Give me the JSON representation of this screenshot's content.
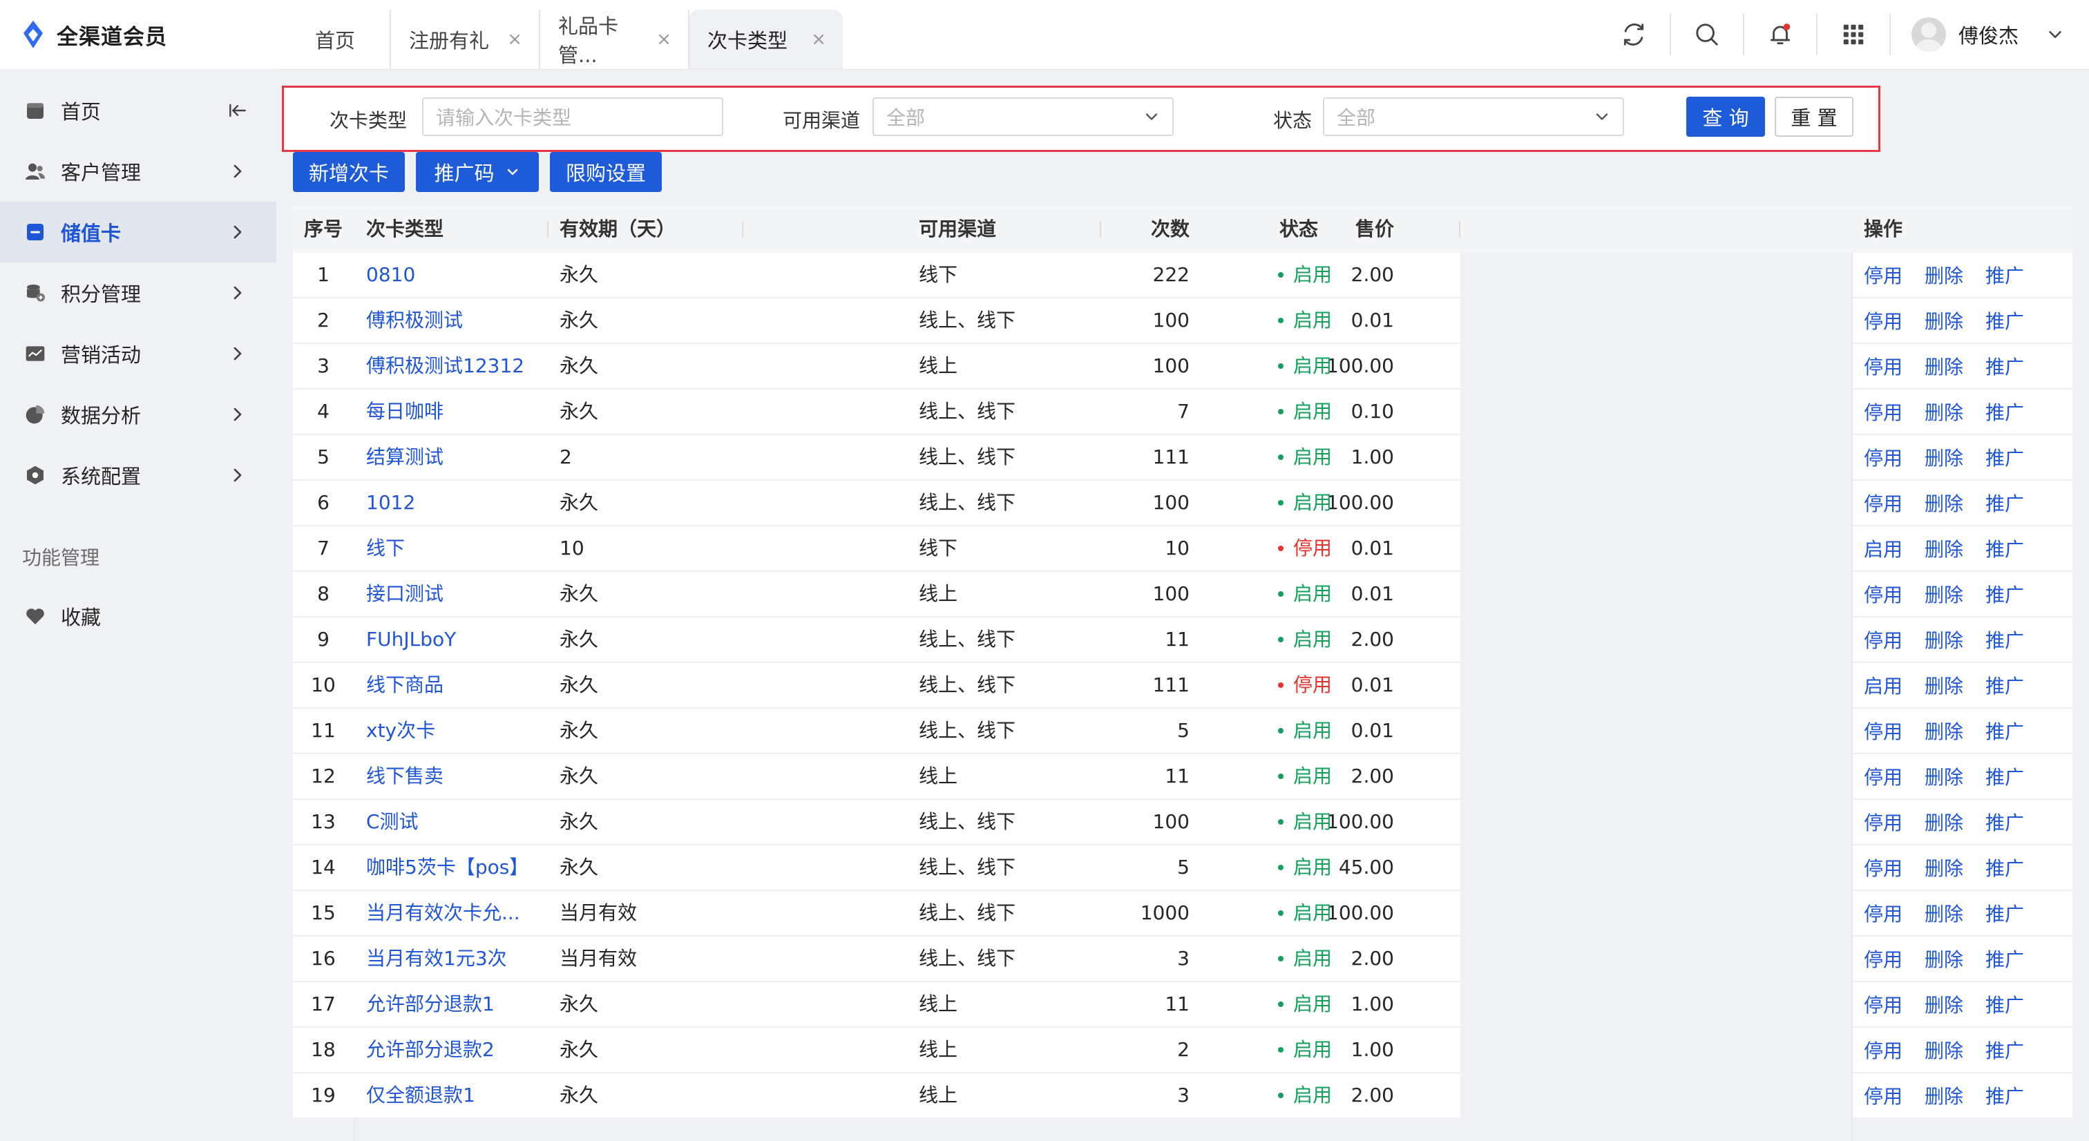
{
  "app": {
    "title": "全渠道会员"
  },
  "tabs": [
    {
      "label": "首页",
      "closable": false
    },
    {
      "label": "注册有礼",
      "closable": true
    },
    {
      "label": "礼品卡管...",
      "closable": true
    },
    {
      "label": "次卡类型",
      "closable": true,
      "active": true
    }
  ],
  "close_glyph": "×",
  "user": {
    "name": "傅俊杰"
  },
  "sidebar": {
    "items": [
      {
        "label": "首页",
        "icon": "home-icon"
      },
      {
        "label": "客户管理",
        "icon": "user-icon"
      },
      {
        "label": "储值卡",
        "icon": "card-icon",
        "active": true
      },
      {
        "label": "积分管理",
        "icon": "coins-icon"
      },
      {
        "label": "营销活动",
        "icon": "chart-board-icon"
      },
      {
        "label": "数据分析",
        "icon": "pie-icon"
      },
      {
        "label": "系统配置",
        "icon": "hexagon-icon"
      }
    ],
    "section": "功能管理",
    "favorites": {
      "label": "收藏",
      "icon": "heart-icon"
    }
  },
  "filters": {
    "card_type": {
      "label": "次卡类型",
      "placeholder": "请输入次卡类型"
    },
    "channel": {
      "label": "可用渠道",
      "value": "全部"
    },
    "status": {
      "label": "状态",
      "value": "全部"
    },
    "query_label": "查 询",
    "reset_label": "重 置"
  },
  "actions": {
    "add_label": "新增次卡",
    "promo_label": "推广码",
    "limit_label": "限购设置"
  },
  "table": {
    "headers": {
      "no": "序号",
      "type": "次卡类型",
      "validity": "有效期（天）",
      "count": "次数",
      "channel": "可用渠道",
      "price": "售价",
      "status": "状态",
      "ops": "操作"
    },
    "op_delete": "删除",
    "op_promote": "推广",
    "rows": [
      {
        "no": "1",
        "type": "0810",
        "validity": "永久",
        "count": "222",
        "channel": "线下",
        "price": "2.00",
        "status": "启用",
        "enabled": true,
        "toggle": "停用"
      },
      {
        "no": "2",
        "type": "傅积极测试",
        "validity": "永久",
        "count": "100",
        "channel": "线上、线下",
        "price": "0.01",
        "status": "启用",
        "enabled": true,
        "toggle": "停用"
      },
      {
        "no": "3",
        "type": "傅积极测试12312",
        "validity": "永久",
        "count": "100",
        "channel": "线上",
        "price": "100.00",
        "status": "启用",
        "enabled": true,
        "toggle": "停用"
      },
      {
        "no": "4",
        "type": "每日咖啡",
        "validity": "永久",
        "count": "7",
        "channel": "线上、线下",
        "price": "0.10",
        "status": "启用",
        "enabled": true,
        "toggle": "停用"
      },
      {
        "no": "5",
        "type": "结算测试",
        "validity": "2",
        "count": "111",
        "channel": "线上、线下",
        "price": "1.00",
        "status": "启用",
        "enabled": true,
        "toggle": "停用"
      },
      {
        "no": "6",
        "type": "1012",
        "validity": "永久",
        "count": "100",
        "channel": "线上、线下",
        "price": "100.00",
        "status": "启用",
        "enabled": true,
        "toggle": "停用"
      },
      {
        "no": "7",
        "type": "线下",
        "validity": "10",
        "count": "10",
        "channel": "线下",
        "price": "0.01",
        "status": "停用",
        "enabled": false,
        "toggle": "启用"
      },
      {
        "no": "8",
        "type": "接口测试",
        "validity": "永久",
        "count": "100",
        "channel": "线上",
        "price": "0.01",
        "status": "启用",
        "enabled": true,
        "toggle": "停用"
      },
      {
        "no": "9",
        "type": "FUhJLboY",
        "validity": "永久",
        "count": "11",
        "channel": "线上、线下",
        "price": "2.00",
        "status": "启用",
        "enabled": true,
        "toggle": "停用"
      },
      {
        "no": "10",
        "type": "线下商品",
        "validity": "永久",
        "count": "111",
        "channel": "线上、线下",
        "price": "0.01",
        "status": "停用",
        "enabled": false,
        "toggle": "启用"
      },
      {
        "no": "11",
        "type": "xty次卡",
        "validity": "永久",
        "count": "5",
        "channel": "线上、线下",
        "price": "0.01",
        "status": "启用",
        "enabled": true,
        "toggle": "停用"
      },
      {
        "no": "12",
        "type": "线下售卖",
        "validity": "永久",
        "count": "11",
        "channel": "线上",
        "price": "2.00",
        "status": "启用",
        "enabled": true,
        "toggle": "停用"
      },
      {
        "no": "13",
        "type": "C测试",
        "validity": "永久",
        "count": "100",
        "channel": "线上、线下",
        "price": "100.00",
        "status": "启用",
        "enabled": true,
        "toggle": "停用"
      },
      {
        "no": "14",
        "type": "咖啡5茨卡【pos】",
        "validity": "永久",
        "count": "5",
        "channel": "线上、线下",
        "price": "45.00",
        "status": "启用",
        "enabled": true,
        "toggle": "停用"
      },
      {
        "no": "15",
        "type": "当月有效次卡允...",
        "validity": "当月有效",
        "count": "1000",
        "channel": "线上、线下",
        "price": "100.00",
        "status": "启用",
        "enabled": true,
        "toggle": "停用"
      },
      {
        "no": "16",
        "type": "当月有效1元3次",
        "validity": "当月有效",
        "count": "3",
        "channel": "线上、线下",
        "price": "2.00",
        "status": "启用",
        "enabled": true,
        "toggle": "停用"
      },
      {
        "no": "17",
        "type": "允许部分退款1",
        "validity": "永久",
        "count": "11",
        "channel": "线上",
        "price": "1.00",
        "status": "启用",
        "enabled": true,
        "toggle": "停用"
      },
      {
        "no": "18",
        "type": "允许部分退款2",
        "validity": "永久",
        "count": "2",
        "channel": "线上",
        "price": "1.00",
        "status": "启用",
        "enabled": true,
        "toggle": "停用"
      },
      {
        "no": "19",
        "type": "仅全额退款1",
        "validity": "永久",
        "count": "3",
        "channel": "线上",
        "price": "2.00",
        "status": "启用",
        "enabled": true,
        "toggle": "停用"
      }
    ]
  },
  "colors": {
    "accent": "#1e56d6",
    "enabled": "#12a05c",
    "disabled": "#e5322d",
    "highlight_border": "#e63946"
  }
}
